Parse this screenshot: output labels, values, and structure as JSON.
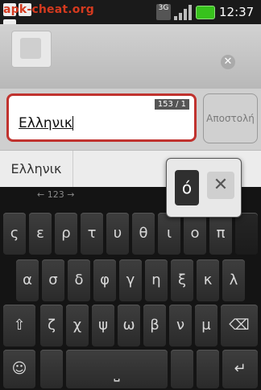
{
  "status_bar": {
    "watermark": "apk-cheat.org",
    "network": "3G",
    "clock": "12:37"
  },
  "compose": {
    "clear_icon": "close-circle-icon",
    "text_value": "Ελληνικ",
    "counter": "153 / 1",
    "send_label": "Αποστολή"
  },
  "suggestions": {
    "items": [
      "Ελληνικ"
    ]
  },
  "keyboard": {
    "hint": "← 123 →",
    "row1": [
      "ς",
      "ε",
      "ρ",
      "τ",
      "υ",
      "θ",
      "ι",
      "ο",
      "π"
    ],
    "row2": [
      "α",
      "σ",
      "δ",
      "φ",
      "γ",
      "η",
      "ξ",
      "κ",
      "λ"
    ],
    "row3": [
      "ζ",
      "χ",
      "ψ",
      "ω",
      "β",
      "ν",
      "μ"
    ],
    "shift_icon": "shift-icon",
    "backspace_icon": "backspace-icon",
    "mic_icon": "microphone-icon",
    "space_icon": "space-icon",
    "enter_icon": "enter-icon"
  },
  "popup": {
    "key": "ό",
    "close_icon": "close-icon"
  }
}
